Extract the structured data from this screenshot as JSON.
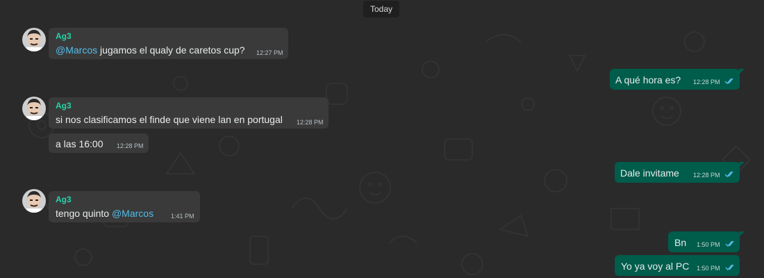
{
  "date_label": "Today",
  "colors": {
    "background": "#2a2a2a",
    "incoming_bubble": "#3a3a3a",
    "outgoing_bubble": "#005c4b",
    "sender_name": "#25d3a8",
    "mention": "#53bdeb",
    "read_ticks": "#53bdeb"
  },
  "messages": [
    {
      "sender": "Ag3",
      "mention": "@Marcos",
      "text": " jugamos el qualy de caretos cup?",
      "time": "12:27 PM"
    },
    {
      "text": "A qué hora es?",
      "time": "12:28 PM",
      "status": "read"
    },
    {
      "sender": "Ag3",
      "text": "si nos clasificamos el finde que viene lan en portugal",
      "time": "12:28 PM"
    },
    {
      "text": "a las 16:00",
      "time": "12:28 PM"
    },
    {
      "text": "Dale invitame",
      "time": "12:28 PM",
      "status": "read"
    },
    {
      "sender": "Ag3",
      "text": "tengo quinto  ",
      "mention": "@Marcos",
      "time": "1:41 PM"
    },
    {
      "text": "Bn",
      "time": "1:50 PM",
      "status": "read"
    },
    {
      "text": "Yo ya voy al PC",
      "time": "1:50 PM",
      "status": "read"
    }
  ]
}
